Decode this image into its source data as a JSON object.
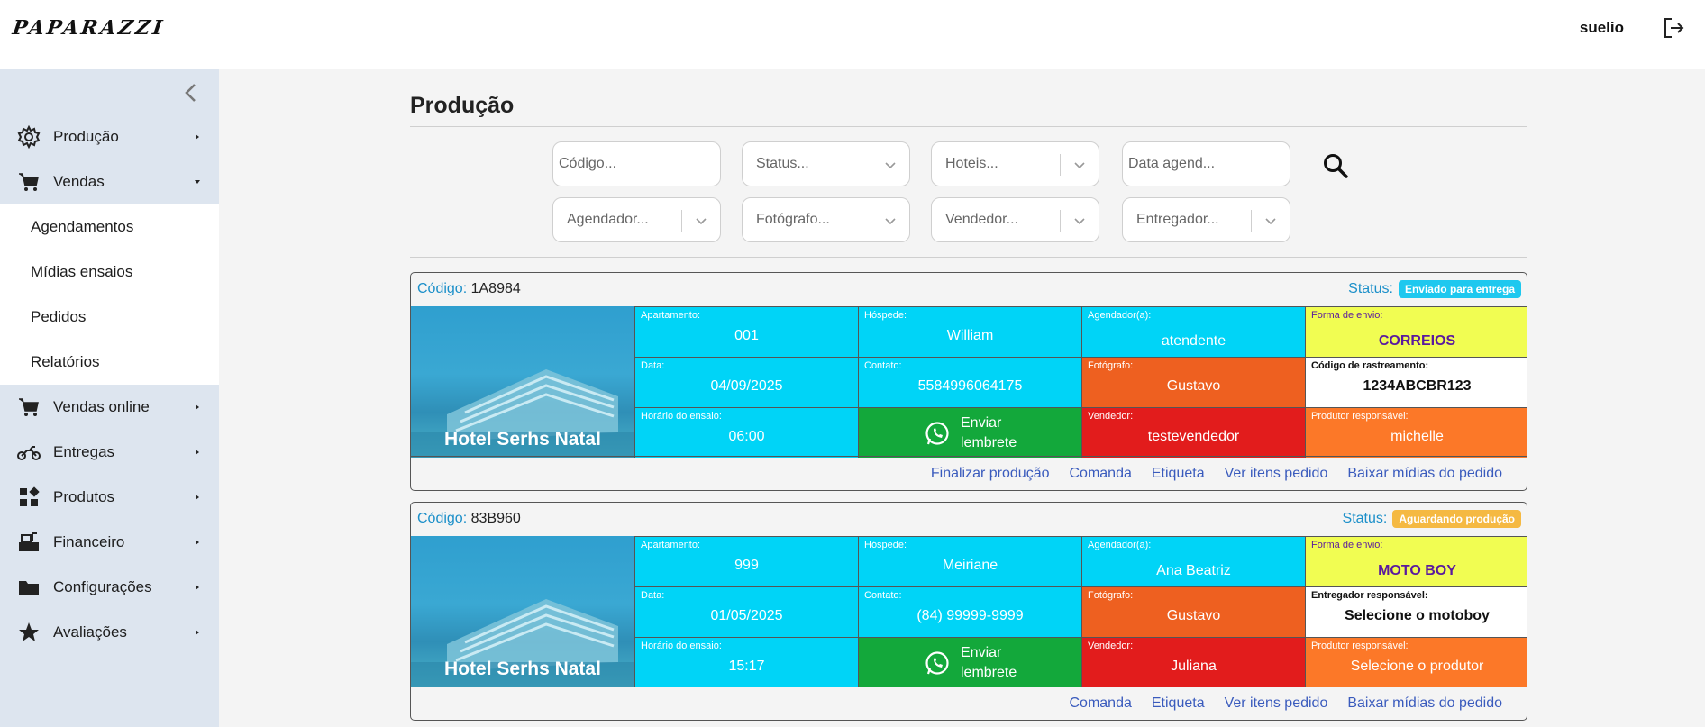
{
  "header": {
    "logo": "PAPARAZZI",
    "user": "suelio"
  },
  "sidebar": {
    "items": [
      {
        "label": "Produção",
        "icon": "gear-icon"
      },
      {
        "label": "Vendas",
        "icon": "cart-icon"
      },
      {
        "label": "Vendas online",
        "icon": "cart-icon"
      },
      {
        "label": "Entregas",
        "icon": "motorcycle-icon"
      },
      {
        "label": "Produtos",
        "icon": "grid-icon"
      },
      {
        "label": "Financeiro",
        "icon": "cash-register-icon"
      },
      {
        "label": "Configurações",
        "icon": "folder-icon"
      },
      {
        "label": "Avaliações",
        "icon": "star-icon"
      }
    ],
    "sub_items": [
      "Agendamentos",
      "Mídias ensaios",
      "Pedidos",
      "Relatórios"
    ]
  },
  "main": {
    "title": "Produção",
    "filters": {
      "codigo": "Código...",
      "status": "Status...",
      "hoteis": "Hoteis...",
      "data": "Data agend...",
      "agendador": "Agendador...",
      "fotografo": "Fotógrafo...",
      "vendedor": "Vendedor...",
      "entregador": "Entregador..."
    }
  },
  "orders": [
    {
      "code_label": "Código:",
      "code": "1A8984",
      "status_label": "Status:",
      "status": "Enviado para entrega",
      "status_color": "#1ec8ef",
      "hotel": "Hotel Serhs Natal",
      "apartamento_label": "Apartamento:",
      "apartamento": "001",
      "hospede_label": "Hóspede:",
      "hospede": "William",
      "agendador_label": "Agendador(a):",
      "agendador": "atendente",
      "envio_label": "Forma de envio:",
      "envio": "CORREIOS",
      "data_label": "Data:",
      "data": "04/09/2025",
      "contato_label": "Contato:",
      "contato": "5584996064175",
      "fotografo_label": "Fotógrafo:",
      "fotografo": "Gustavo",
      "extra_label": "Código de rastreamento:",
      "extra": "1234ABCBR123",
      "horario_label": "Horário do ensaio:",
      "horario": "06:00",
      "lembrete_1": "Enviar",
      "lembrete_2": "lembrete",
      "vendedor_label": "Vendedor:",
      "vendedor": "testevendedor",
      "produtor_label": "Produtor responsável:",
      "produtor": "michelle",
      "actions": [
        "Finalizar produção",
        "Comanda",
        "Etiqueta",
        "Ver itens pedido",
        "Baixar mídias do pedido"
      ]
    },
    {
      "code_label": "Código:",
      "code": "83B960",
      "status_label": "Status:",
      "status": "Aguardando produção",
      "status_color": "#f5b942",
      "hotel": "Hotel Serhs Natal",
      "apartamento_label": "Apartamento:",
      "apartamento": "999",
      "hospede_label": "Hóspede:",
      "hospede": "Meiriane",
      "agendador_label": "Agendador(a):",
      "agendador": "Ana Beatriz",
      "envio_label": "Forma de envio:",
      "envio": "MOTO BOY",
      "data_label": "Data:",
      "data": "01/05/2025",
      "contato_label": "Contato:",
      "contato": "(84) 99999-9999",
      "fotografo_label": "Fotógrafo:",
      "fotografo": "Gustavo",
      "extra_label": "Entregador responsável:",
      "extra": "Selecione o motoboy",
      "horario_label": "Horário do ensaio:",
      "horario": "15:17",
      "lembrete_1": "Enviar",
      "lembrete_2": "lembrete",
      "vendedor_label": "Vendedor:",
      "vendedor": "Juliana",
      "produtor_label": "Produtor responsável:",
      "produtor": "Selecione o produtor",
      "actions": [
        "Comanda",
        "Etiqueta",
        "Ver itens pedido",
        "Baixar mídias do pedido"
      ]
    }
  ]
}
